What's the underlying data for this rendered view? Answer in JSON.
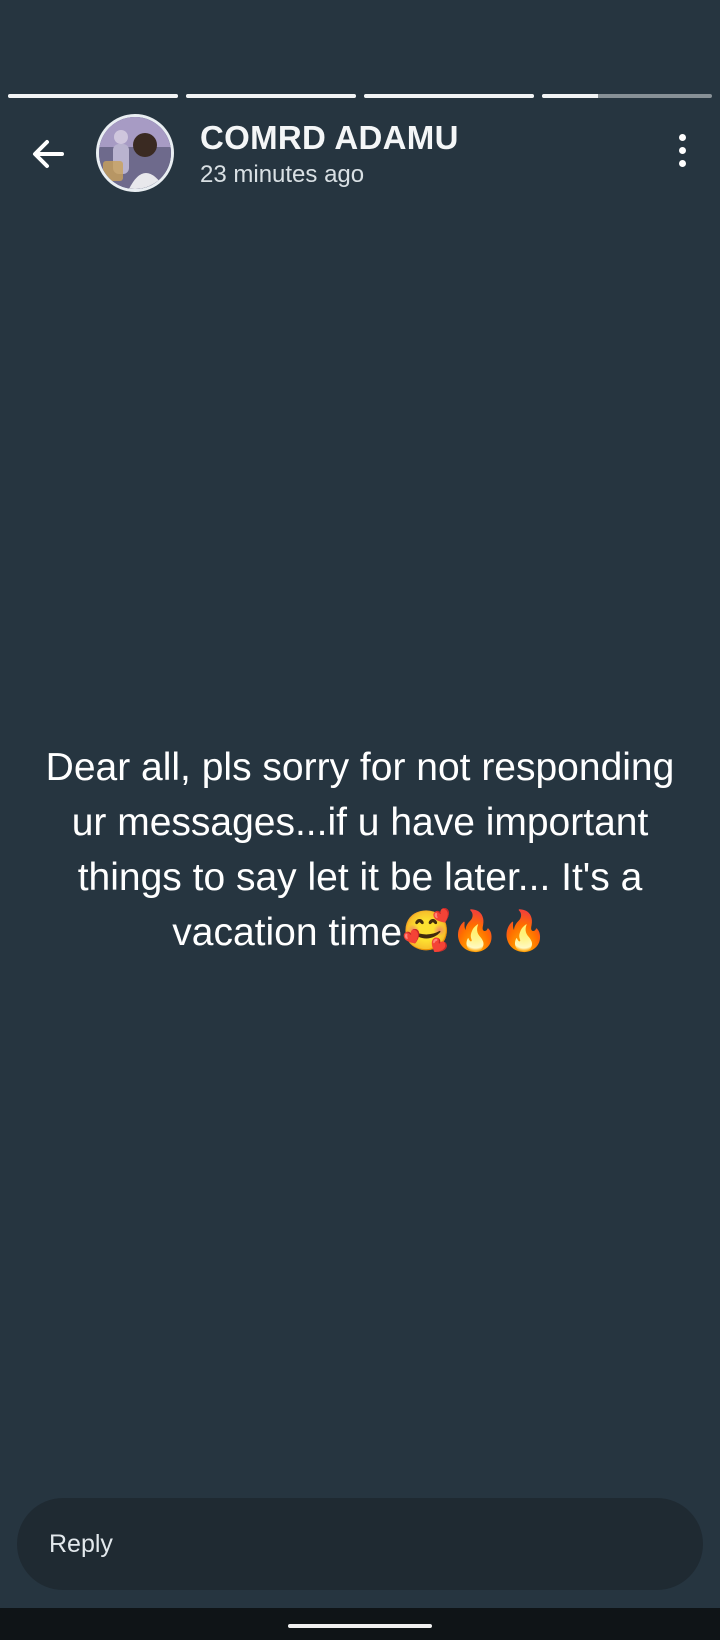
{
  "progress": {
    "segments": [
      1,
      1,
      1,
      0.33
    ]
  },
  "header": {
    "back_icon": "arrow-left-icon",
    "avatar_icon": "contact-avatar",
    "contact_name": "COMRD ADAMU",
    "timestamp": "23 minutes ago",
    "menu_icon": "more-vertical-icon"
  },
  "status": {
    "line1": "Dear all, pls sorry for not responding",
    "line2": "ur messages...if u have important",
    "line3": "things to say let it be later... It's a",
    "line4_text": "vacation time",
    "emoji_1": "🥰",
    "emoji_2": "🔥",
    "emoji_3": "🔥",
    "background_color": "#263540"
  },
  "reply": {
    "placeholder": "Reply"
  }
}
